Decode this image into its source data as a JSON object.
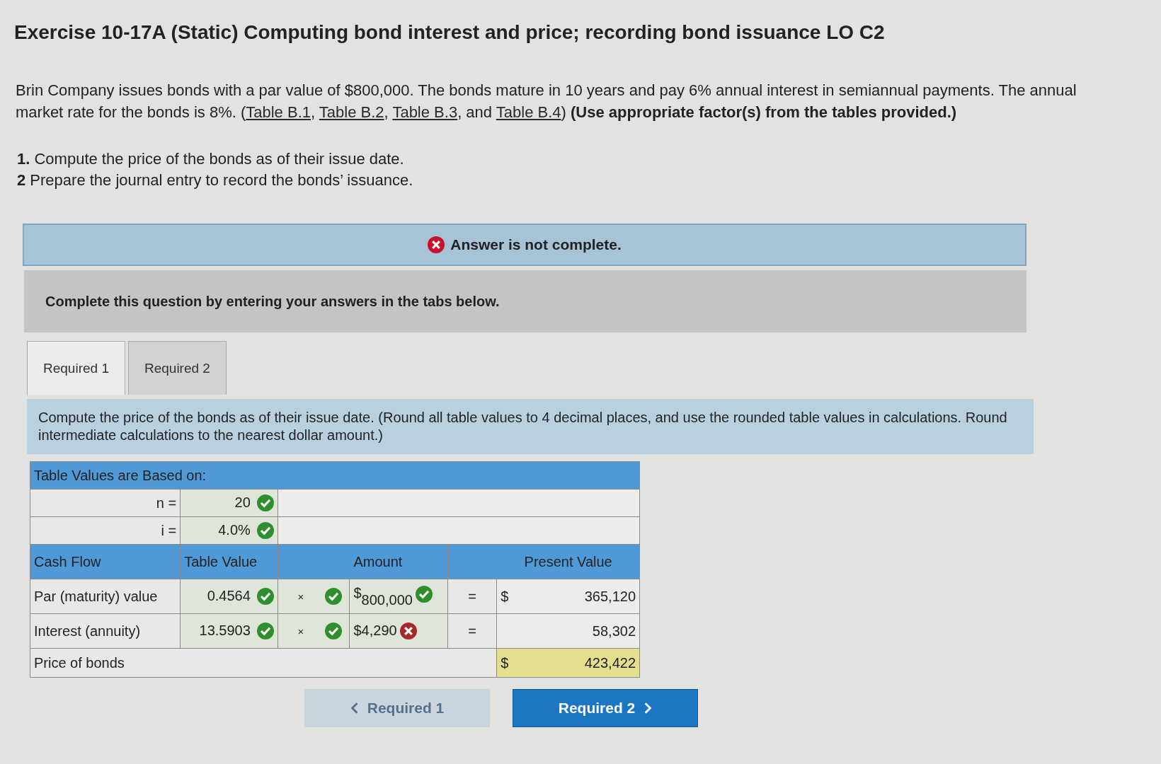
{
  "title": "Exercise 10-17A (Static) Computing bond interest and price; recording bond issuance LO C2",
  "intro": [
    {
      "kind": "text",
      "text": "Brin Company issues bonds with a par value of $800,000. The bonds mature in 10 years and pay 6% annual interest in semiannual payments. The annual market rate for the bonds is 8%. ("
    },
    {
      "kind": "link",
      "text": "Table B.1"
    },
    {
      "kind": "text",
      "text": ", "
    },
    {
      "kind": "link",
      "text": "Table B.2"
    },
    {
      "kind": "text",
      "text": ", "
    },
    {
      "kind": "link",
      "text": "Table B.3"
    },
    {
      "kind": "text",
      "text": ", and "
    },
    {
      "kind": "link",
      "text": "Table B.4"
    },
    {
      "kind": "text",
      "text": ") **(Use appropriate factor(s) from the tables provided.)**"
    }
  ],
  "steps": [
    {
      "number": "1.",
      "text": "Compute the price of the bonds as of their issue date."
    },
    {
      "number": "2",
      "text": "Prepare the journal entry to record the bonds’ issuance."
    }
  ],
  "status": {
    "complete": false,
    "text": "Answer is not complete."
  },
  "instruction": "Complete this question by entering your answers in the tabs below.",
  "tabs": [
    {
      "label": "Required 1",
      "selected": true
    },
    {
      "label": "Required 2",
      "selected": false
    }
  ],
  "prompt": "Compute the price of the bonds as of their issue date. (Round all table values to 4 decimal places, and use the rounded table values in calculations. Round intermediate calculations to the nearest dollar amount.)",
  "table": {
    "heading": "Table Values are Based on:",
    "basis": [
      {
        "label": "n =",
        "value": "20",
        "correct": true
      },
      {
        "label": "i =",
        "value": "4.0%",
        "correct": true
      }
    ],
    "columns": [
      "Cash Flow",
      "Table Value",
      "Amount",
      "Present Value"
    ],
    "rows": [
      {
        "label": "Par (maturity) value",
        "table_value": "0.4564",
        "table_correct": true,
        "operator": "×",
        "operator_correct": true,
        "amount_prefix": "$",
        "amount": "800,000",
        "amount_correct": true,
        "equals": "=",
        "pv_prefix": "$",
        "pv": "365,120"
      },
      {
        "label": "Interest (annuity)",
        "table_value": "13.5903",
        "table_correct": true,
        "operator": "×",
        "operator_correct": true,
        "amount_prefix": "$",
        "amount": "4,290",
        "amount_correct": false,
        "equals": "=",
        "pv": "58,302"
      }
    ],
    "total": {
      "label": "Price of bonds",
      "prefix": "$",
      "value": "423,422"
    }
  },
  "nav": [
    {
      "label": "Required 1",
      "kind": "prev",
      "disabled": true
    },
    {
      "label": "Required 2",
      "kind": "next",
      "disabled": false
    }
  ]
}
